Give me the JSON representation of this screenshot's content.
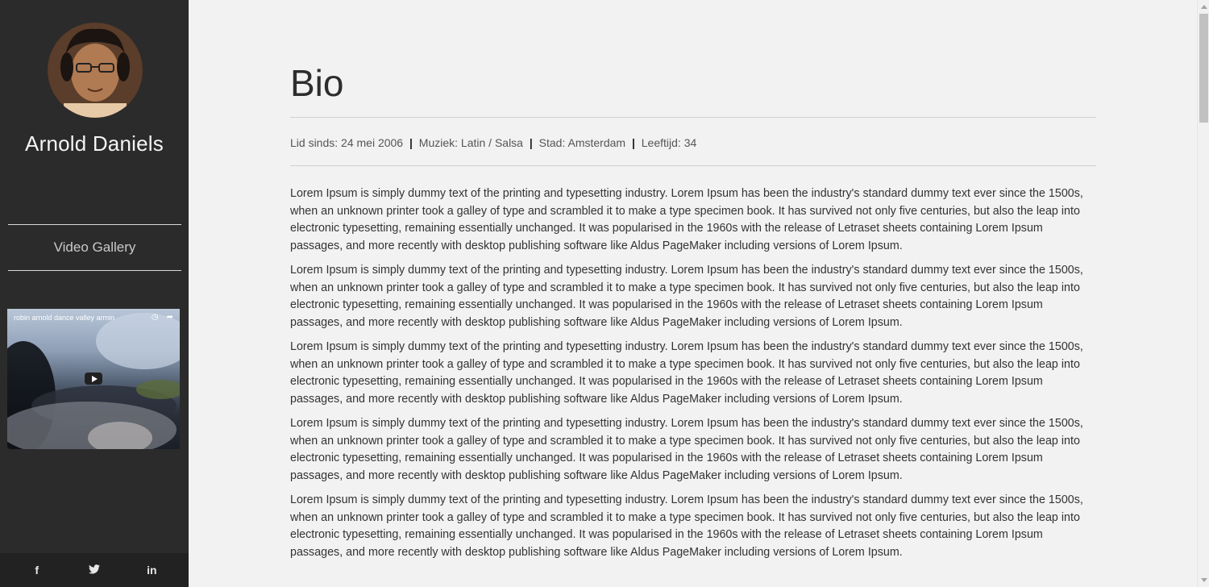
{
  "sidebar": {
    "name": "Arnold Daniels",
    "nav_item": "Video Gallery",
    "video": {
      "title": "robin arnold dance valley armin"
    },
    "social": {
      "facebook": "f",
      "twitter": "🐦",
      "linkedin": "in"
    }
  },
  "main": {
    "title": "Bio",
    "meta": {
      "member_since": "Lid sinds: 24 mei 2006",
      "music": "Muziek: Latin / Salsa",
      "city": "Stad: Amsterdam",
      "age": "Leeftijd: 34",
      "separator": "|"
    },
    "paragraphs": [
      "Lorem Ipsum is simply dummy text of the printing and typesetting industry. Lorem Ipsum has been the industry's standard dummy text ever since the 1500s, when an unknown printer took a galley of type and scrambled it to make a type specimen book. It has survived not only five centuries, but also the leap into electronic typesetting, remaining essentially unchanged. It was popularised in the 1960s with the release of Letraset sheets containing Lorem Ipsum passages, and more recently with desktop publishing software like Aldus PageMaker including versions of Lorem Ipsum.",
      "Lorem Ipsum is simply dummy text of the printing and typesetting industry. Lorem Ipsum has been the industry's standard dummy text ever since the 1500s, when an unknown printer took a galley of type and scrambled it to make a type specimen book. It has survived not only five centuries, but also the leap into electronic typesetting, remaining essentially unchanged. It was popularised in the 1960s with the release of Letraset sheets containing Lorem Ipsum passages, and more recently with desktop publishing software like Aldus PageMaker including versions of Lorem Ipsum.",
      "Lorem Ipsum is simply dummy text of the printing and typesetting industry. Lorem Ipsum has been the industry's standard dummy text ever since the 1500s, when an unknown printer took a galley of type and scrambled it to make a type specimen book. It has survived not only five centuries, but also the leap into electronic typesetting, remaining essentially unchanged. It was popularised in the 1960s with the release of Letraset sheets containing Lorem Ipsum passages, and more recently with desktop publishing software like Aldus PageMaker including versions of Lorem Ipsum.",
      "Lorem Ipsum is simply dummy text of the printing and typesetting industry. Lorem Ipsum has been the industry's standard dummy text ever since the 1500s, when an unknown printer took a galley of type and scrambled it to make a type specimen book. It has survived not only five centuries, but also the leap into electronic typesetting, remaining essentially unchanged. It was popularised in the 1960s with the release of Letraset sheets containing Lorem Ipsum passages, and more recently with desktop publishing software like Aldus PageMaker including versions of Lorem Ipsum.",
      "Lorem Ipsum is simply dummy text of the printing and typesetting industry. Lorem Ipsum has been the industry's standard dummy text ever since the 1500s, when an unknown printer took a galley of type and scrambled it to make a type specimen book. It has survived not only five centuries, but also the leap into electronic typesetting, remaining essentially unchanged. It was popularised in the 1960s with the release of Letraset sheets containing Lorem Ipsum passages, and more recently with desktop publishing software like Aldus PageMaker including versions of Lorem Ipsum."
    ]
  },
  "colors": {
    "sidebar_bg": "#2b2b2b",
    "social_bar_bg": "#222222",
    "page_bg": "#f2f2f2",
    "text": "#333333"
  },
  "icons": {
    "facebook": "facebook-icon",
    "twitter": "twitter-icon",
    "linkedin": "linkedin-icon",
    "play": "play-icon",
    "clock": "watch-later-icon",
    "share": "share-icon"
  }
}
